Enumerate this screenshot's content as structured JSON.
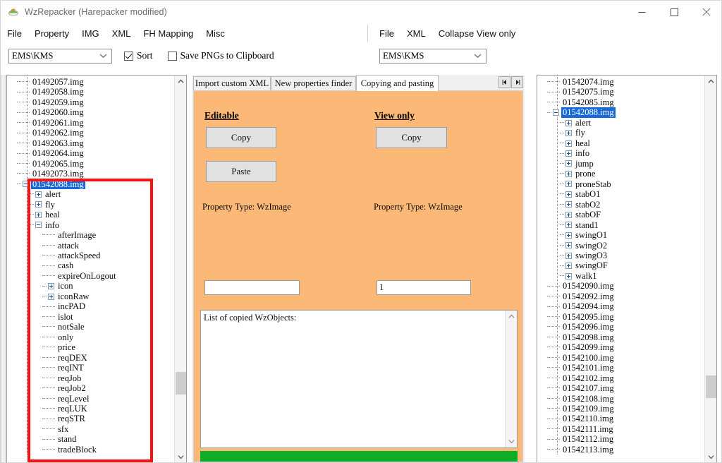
{
  "window": {
    "title": "WzRepacker (Harepacker modified)",
    "icon": "app-icon",
    "controls": {
      "minimize": "minimize-icon",
      "maximize": "maximize-icon",
      "close": "close-icon"
    }
  },
  "menubar_left": {
    "items": [
      "File",
      "Property",
      "IMG",
      "XML",
      "FH Mapping",
      "Misc"
    ]
  },
  "menubar_right": {
    "items": [
      "File",
      "XML",
      "Collapse View only"
    ]
  },
  "toolbar_left": {
    "combo_value": "EMS\\KMS",
    "sort": {
      "label": "Sort",
      "checked": true
    },
    "save_pngs": {
      "label": "Save PNGs to Clipboard",
      "checked": false
    }
  },
  "toolbar_right": {
    "combo_value": "EMS\\KMS"
  },
  "center": {
    "tabs": [
      {
        "label": "Import custom XML",
        "active": false
      },
      {
        "label": "New properties finder",
        "active": false
      },
      {
        "label": "Copying and pasting",
        "active": true
      }
    ],
    "tab_nav": {
      "prev": "scroll-left-icon",
      "next": "scroll-right-icon"
    },
    "editable": {
      "heading": "Editable",
      "copy_label": "Copy",
      "paste_label": "Paste",
      "property_type": "Property Type: WzImage",
      "textbox_value": ""
    },
    "view_only": {
      "heading": "View only",
      "copy_label": "Copy",
      "property_type": "Property Type: WzImage",
      "textbox_value": "1"
    },
    "copied_list": {
      "text": "List of copied WzObjects:"
    },
    "progress": {
      "color": "#0DAD28",
      "value": 100
    },
    "panel_color": "#FBB877"
  },
  "left_tree": {
    "nodes": [
      {
        "label": "01492057.img",
        "depth": 1,
        "kind": "leaf"
      },
      {
        "label": "01492058.img",
        "depth": 1,
        "kind": "leaf"
      },
      {
        "label": "01492059.img",
        "depth": 1,
        "kind": "leaf"
      },
      {
        "label": "01492060.img",
        "depth": 1,
        "kind": "leaf"
      },
      {
        "label": "01492061.img",
        "depth": 1,
        "kind": "leaf"
      },
      {
        "label": "01492062.img",
        "depth": 1,
        "kind": "leaf"
      },
      {
        "label": "01492063.img",
        "depth": 1,
        "kind": "leaf"
      },
      {
        "label": "01492064.img",
        "depth": 1,
        "kind": "leaf"
      },
      {
        "label": "01492065.img",
        "depth": 1,
        "kind": "leaf"
      },
      {
        "label": "01492073.img",
        "depth": 1,
        "kind": "leaf"
      },
      {
        "label": "01542088.img",
        "depth": 1,
        "kind": "minus",
        "selected": true
      },
      {
        "label": "alert",
        "depth": 2,
        "kind": "plus"
      },
      {
        "label": "fly",
        "depth": 2,
        "kind": "plus"
      },
      {
        "label": "heal",
        "depth": 2,
        "kind": "plus"
      },
      {
        "label": "info",
        "depth": 2,
        "kind": "minus"
      },
      {
        "label": "afterImage",
        "depth": 3,
        "kind": "leaf"
      },
      {
        "label": "attack",
        "depth": 3,
        "kind": "leaf"
      },
      {
        "label": "attackSpeed",
        "depth": 3,
        "kind": "leaf"
      },
      {
        "label": "cash",
        "depth": 3,
        "kind": "leaf"
      },
      {
        "label": "expireOnLogout",
        "depth": 3,
        "kind": "leaf"
      },
      {
        "label": "icon",
        "depth": 3,
        "kind": "plus"
      },
      {
        "label": "iconRaw",
        "depth": 3,
        "kind": "plus"
      },
      {
        "label": "incPAD",
        "depth": 3,
        "kind": "leaf"
      },
      {
        "label": "islot",
        "depth": 3,
        "kind": "leaf"
      },
      {
        "label": "notSale",
        "depth": 3,
        "kind": "leaf"
      },
      {
        "label": "only",
        "depth": 3,
        "kind": "leaf"
      },
      {
        "label": "price",
        "depth": 3,
        "kind": "leaf"
      },
      {
        "label": "reqDEX",
        "depth": 3,
        "kind": "leaf"
      },
      {
        "label": "reqINT",
        "depth": 3,
        "kind": "leaf"
      },
      {
        "label": "reqJob",
        "depth": 3,
        "kind": "leaf"
      },
      {
        "label": "reqJob2",
        "depth": 3,
        "kind": "leaf"
      },
      {
        "label": "reqLevel",
        "depth": 3,
        "kind": "leaf"
      },
      {
        "label": "reqLUK",
        "depth": 3,
        "kind": "leaf"
      },
      {
        "label": "reqSTR",
        "depth": 3,
        "kind": "leaf"
      },
      {
        "label": "sfx",
        "depth": 3,
        "kind": "leaf"
      },
      {
        "label": "stand",
        "depth": 3,
        "kind": "leaf"
      },
      {
        "label": "tradeBlock",
        "depth": 3,
        "kind": "leaf"
      }
    ]
  },
  "right_tree": {
    "nodes": [
      {
        "label": "01542074.img",
        "depth": 1,
        "kind": "leaf"
      },
      {
        "label": "01542075.img",
        "depth": 1,
        "kind": "leaf"
      },
      {
        "label": "01542085.img",
        "depth": 1,
        "kind": "leaf"
      },
      {
        "label": "01542088.img",
        "depth": 1,
        "kind": "minus",
        "selected": true
      },
      {
        "label": "alert",
        "depth": 2,
        "kind": "plus"
      },
      {
        "label": "fly",
        "depth": 2,
        "kind": "plus"
      },
      {
        "label": "heal",
        "depth": 2,
        "kind": "plus"
      },
      {
        "label": "info",
        "depth": 2,
        "kind": "plus"
      },
      {
        "label": "jump",
        "depth": 2,
        "kind": "plus"
      },
      {
        "label": "prone",
        "depth": 2,
        "kind": "plus"
      },
      {
        "label": "proneStab",
        "depth": 2,
        "kind": "plus"
      },
      {
        "label": "stabO1",
        "depth": 2,
        "kind": "plus"
      },
      {
        "label": "stabO2",
        "depth": 2,
        "kind": "plus"
      },
      {
        "label": "stabOF",
        "depth": 2,
        "kind": "plus"
      },
      {
        "label": "stand1",
        "depth": 2,
        "kind": "plus"
      },
      {
        "label": "swingO1",
        "depth": 2,
        "kind": "plus"
      },
      {
        "label": "swingO2",
        "depth": 2,
        "kind": "plus"
      },
      {
        "label": "swingO3",
        "depth": 2,
        "kind": "plus"
      },
      {
        "label": "swingOF",
        "depth": 2,
        "kind": "plus"
      },
      {
        "label": "walk1",
        "depth": 2,
        "kind": "plus"
      },
      {
        "label": "01542090.img",
        "depth": 1,
        "kind": "leaf"
      },
      {
        "label": "01542092.img",
        "depth": 1,
        "kind": "leaf"
      },
      {
        "label": "01542094.img",
        "depth": 1,
        "kind": "leaf"
      },
      {
        "label": "01542095.img",
        "depth": 1,
        "kind": "leaf"
      },
      {
        "label": "01542096.img",
        "depth": 1,
        "kind": "leaf"
      },
      {
        "label": "01542098.img",
        "depth": 1,
        "kind": "leaf"
      },
      {
        "label": "01542099.img",
        "depth": 1,
        "kind": "leaf"
      },
      {
        "label": "01542100.img",
        "depth": 1,
        "kind": "leaf"
      },
      {
        "label": "01542101.img",
        "depth": 1,
        "kind": "leaf"
      },
      {
        "label": "01542102.img",
        "depth": 1,
        "kind": "leaf"
      },
      {
        "label": "01542107.img",
        "depth": 1,
        "kind": "leaf"
      },
      {
        "label": "01542108.img",
        "depth": 1,
        "kind": "leaf"
      },
      {
        "label": "01542109.img",
        "depth": 1,
        "kind": "leaf"
      },
      {
        "label": "01542110.img",
        "depth": 1,
        "kind": "leaf"
      },
      {
        "label": "01542111.img",
        "depth": 1,
        "kind": "leaf"
      },
      {
        "label": "01542112.img",
        "depth": 1,
        "kind": "leaf"
      },
      {
        "label": "01542113.img",
        "depth": 1,
        "kind": "leaf"
      }
    ]
  },
  "annotation": {
    "highlight_color": "#ff1111"
  }
}
